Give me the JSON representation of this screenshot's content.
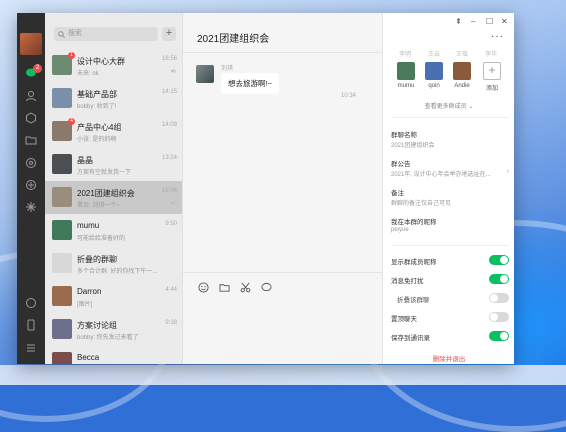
{
  "chats": [
    {
      "name": "设计中心大群",
      "preview": "未来: ok",
      "time": "16:56",
      "badge": "1",
      "muted": true,
      "avatar": "#6c8b73"
    },
    {
      "name": "基础产品部",
      "preview": "bobby: 收到了!",
      "time": "14:15",
      "badge": "",
      "muted": false,
      "avatar": "#7a8fa8"
    },
    {
      "name": "产品中心4组",
      "preview": "小张: 是的的啊",
      "time": "14:09",
      "badge": "4",
      "muted": false,
      "avatar": "#8b7a6c"
    },
    {
      "name": "晶晶",
      "preview": "方案有空就发我一下",
      "time": "13:24",
      "badge": "",
      "muted": false,
      "avatar": "#4b4f52"
    },
    {
      "name": "2021团建组织会",
      "preview": "晋余: 刘琪一个~",
      "time": "18:04",
      "badge": "",
      "muted": true,
      "avatar": "#9a8d7c"
    },
    {
      "name": "mumu",
      "preview": "可能给给准备好的",
      "time": "9:50",
      "badge": "",
      "muted": false,
      "avatar": "#3f7a5a"
    },
    {
      "name": "折叠的群聊",
      "preview": "多个合计群: 好的你找下午一...",
      "time": "",
      "badge": "",
      "muted": false,
      "avatar": "#d8d8d8"
    },
    {
      "name": "Darron",
      "preview": "[图片]",
      "time": "4:44",
      "badge": "",
      "muted": false,
      "avatar": "#9a6b4c"
    },
    {
      "name": "方案讨论组",
      "preview": "bobby: 你先发过来看了",
      "time": "9:38",
      "badge": "",
      "muted": false,
      "avatar": "#6e6f8c"
    },
    {
      "name": "Becca",
      "preview": "",
      "time": "",
      "badge": "",
      "muted": false,
      "avatar": "#7a4c4c"
    }
  ],
  "search": {
    "placeholder": "搜索"
  },
  "rail": {
    "chat_badge": "2"
  },
  "chat": {
    "title": "2021团建组织会",
    "sender": "刘琪",
    "message": "想去旅游啊!~",
    "stamp": "10:34"
  },
  "panel": {
    "ghost_names": [
      "李明",
      "王云",
      "王瑶",
      "李华"
    ],
    "members": [
      {
        "name": "mumu",
        "color": "#4a7a5a"
      },
      {
        "name": "qoin",
        "color": "#4b6fb5"
      },
      {
        "name": "Andie",
        "color": "#8b5a3c"
      }
    ],
    "add_label": "添加",
    "more_members": "查看更多群成员",
    "group_name_label": "群聊名称",
    "group_name_value": "2021团建组织会",
    "notice_label": "群公告",
    "notice_value": "2021年, 设计中心年会举办地选址在...",
    "remark_label": "备注",
    "remark_value": "群聊的备注仅自己可见",
    "nickname_label": "我在本群的昵称",
    "nickname_value": "peiyue",
    "settings": [
      {
        "label": "显示群成员昵称",
        "on": true
      },
      {
        "label": "消息免打扰",
        "on": true
      },
      {
        "label": "折叠该群聊",
        "on": false
      },
      {
        "label": "置顶聊天",
        "on": false
      },
      {
        "label": "保存到通讯录",
        "on": true
      }
    ],
    "exit_label": "删除并退出"
  },
  "colors": {
    "accent": "#07c160",
    "danger": "#e5484d",
    "rail": "#2e2e2e"
  }
}
